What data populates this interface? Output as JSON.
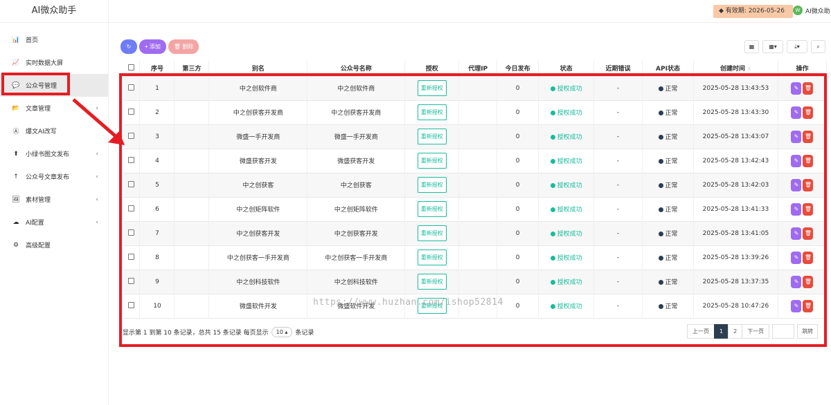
{
  "app": {
    "title": "AI微众助手"
  },
  "topbar": {
    "expiry_label": "有效期: 2026-05-26",
    "user_name": "AI微众助",
    "avatar_text": "W"
  },
  "sidebar": {
    "items": [
      {
        "label": "首页",
        "icon": "bar-chart-icon",
        "glyph": "📊",
        "arrow": ""
      },
      {
        "label": "实时数据大屏",
        "icon": "area-chart-icon",
        "glyph": "📈",
        "arrow": ""
      },
      {
        "label": "公众号管理",
        "icon": "wechat-icon",
        "glyph": "💬",
        "arrow": ""
      },
      {
        "label": "文章管理",
        "icon": "folder-icon",
        "glyph": "📂",
        "arrow": "‹"
      },
      {
        "label": "爆文AI改写",
        "icon": "ai-icon",
        "glyph": "Ⓐ",
        "arrow": ""
      },
      {
        "label": "小绿书图文发布",
        "icon": "upload-icon",
        "glyph": "⬆",
        "arrow": "‹"
      },
      {
        "label": "公众号文章发布",
        "icon": "arrow-up-icon",
        "glyph": "↑",
        "arrow": "‹"
      },
      {
        "label": "素材管理",
        "icon": "image-icon",
        "glyph": "🖼",
        "arrow": "‹"
      },
      {
        "label": "AI配置",
        "icon": "cloud-icon",
        "glyph": "☁",
        "arrow": "‹"
      },
      {
        "label": "高级配置",
        "icon": "gear-icon",
        "glyph": "⚙",
        "arrow": ""
      }
    ]
  },
  "toolbar": {
    "refresh_glyph": "↻",
    "add_label": "+ 添加",
    "delete_label": "🗑 删除"
  },
  "right_tools": {
    "columns_glyph": "▦",
    "grid_glyph": "▦▾",
    "export_glyph": "⤓▾",
    "search_glyph": "⌕"
  },
  "table": {
    "headers": [
      "序号",
      "第三方",
      "别名",
      "公众号名称",
      "授权",
      "代理IP",
      "今日发布",
      "状态",
      "近期错误",
      "API状态",
      "创建时间",
      "操作"
    ],
    "reauth_label": "重新授权",
    "rows": [
      {
        "no": "1",
        "third": "",
        "alias": "中之创软件商",
        "name": "中之创软件商",
        "proxy": "",
        "today": "0",
        "status": "授权成功",
        "error": "-",
        "api": "正常",
        "created": "2025-05-28 13:43:53"
      },
      {
        "no": "2",
        "third": "",
        "alias": "中之创获客开发商",
        "name": "中之创获客开发商",
        "proxy": "",
        "today": "0",
        "status": "授权成功",
        "error": "-",
        "api": "正常",
        "created": "2025-05-28 13:43:30"
      },
      {
        "no": "3",
        "third": "",
        "alias": "微盛一手开发商",
        "name": "微盛一手开发商",
        "proxy": "",
        "today": "0",
        "status": "授权成功",
        "error": "-",
        "api": "正常",
        "created": "2025-05-28 13:43:07"
      },
      {
        "no": "4",
        "third": "",
        "alias": "微盛获客开发",
        "name": "微盛获客开发",
        "proxy": "",
        "today": "0",
        "status": "授权成功",
        "error": "-",
        "api": "正常",
        "created": "2025-05-28 13:42:43"
      },
      {
        "no": "5",
        "third": "",
        "alias": "中之创获客",
        "name": "中之创获客",
        "proxy": "",
        "today": "0",
        "status": "授权成功",
        "error": "-",
        "api": "正常",
        "created": "2025-05-28 13:42:03"
      },
      {
        "no": "6",
        "third": "",
        "alias": "中之创矩阵软件",
        "name": "中之创矩阵软件",
        "proxy": "",
        "today": "0",
        "status": "授权成功",
        "error": "-",
        "api": "正常",
        "created": "2025-05-28 13:41:33"
      },
      {
        "no": "7",
        "third": "",
        "alias": "中之创获客开发",
        "name": "中之创获客开发",
        "proxy": "",
        "today": "0",
        "status": "授权成功",
        "error": "-",
        "api": "正常",
        "created": "2025-05-28 13:41:05"
      },
      {
        "no": "8",
        "third": "",
        "alias": "中之创获客一手开发商",
        "name": "中之创获客一手开发商",
        "proxy": "",
        "today": "0",
        "status": "授权成功",
        "error": "-",
        "api": "正常",
        "created": "2025-05-28 13:39:26"
      },
      {
        "no": "9",
        "third": "",
        "alias": "中之创科技软件",
        "name": "中之创科技软件",
        "proxy": "",
        "today": "0",
        "status": "授权成功",
        "error": "-",
        "api": "正常",
        "created": "2025-05-28 13:37:35"
      },
      {
        "no": "10",
        "third": "",
        "alias": "微盛软件开发",
        "name": "微盛软件开发",
        "proxy": "",
        "today": "0",
        "status": "授权成功",
        "error": "-",
        "api": "正常",
        "created": "2025-05-28 10:47:26"
      }
    ]
  },
  "pagination": {
    "info_prefix": "显示第 1 到第 10 条记录，总共 15 条记录 每页显示",
    "page_size": "10 ▴",
    "info_suffix": "条记录",
    "prev": "上一页",
    "page1": "1",
    "page2": "2",
    "next": "下一页",
    "go": "跳转"
  },
  "watermark": "https://www.huzhan.com/ishop52814",
  "colors": {
    "primary": "#6f7cf7",
    "purple": "#9f6cf0",
    "success": "#18bc9c",
    "danger": "#e74c3c",
    "highlight": "#e41d24"
  }
}
